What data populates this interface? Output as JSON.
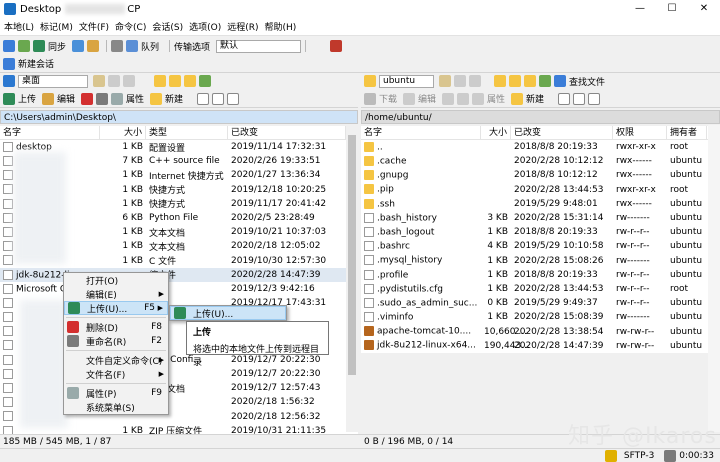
{
  "window": {
    "title": "Desktop",
    "title_suffix": "CP",
    "min": "—",
    "max": "☐",
    "close": "✕"
  },
  "menu": [
    "本地(L)",
    "标记(M)",
    "文件(F)",
    "命令(C)",
    "会话(S)",
    "选项(O)",
    "远程(R)",
    "帮助(H)"
  ],
  "toolbar1": {
    "sync_label": "同步",
    "queue_label": "队列",
    "transfer_label": "传输选项",
    "transfer_value": "默认"
  },
  "toolbar2": {
    "new_session": "新建会话"
  },
  "left": {
    "drive": "桌面",
    "upload": "上传",
    "edit": "编辑",
    "props": "属性",
    "new": "新建",
    "path": "C:\\Users\\admin\\Desktop\\",
    "headers": [
      "名字",
      "大小",
      "类型",
      "已改变"
    ],
    "rows": [
      {
        "name": "desktop",
        "size": "1 KB",
        "type": "配置设置",
        "date": "2019/11/14  17:32:31"
      },
      {
        "name": "",
        "size": "7 KB",
        "type": "C++ source file",
        "date": "2020/2/26  19:33:51"
      },
      {
        "name": "",
        "size": "1 KB",
        "type": "Internet 快捷方式",
        "date": "2020/1/27  13:36:34"
      },
      {
        "name": "",
        "size": "1 KB",
        "type": "快捷方式",
        "date": "2019/12/18  10:20:25"
      },
      {
        "name": "",
        "size": "1 KB",
        "type": "快捷方式",
        "date": "2019/11/17  20:41:42"
      },
      {
        "name": "",
        "size": "6 KB",
        "type": "Python File",
        "date": "2020/2/5  23:28:49"
      },
      {
        "name": "",
        "size": "1 KB",
        "type": "文本文档",
        "date": "2019/10/21  10:37:03"
      },
      {
        "name": "",
        "size": "1 KB",
        "type": "文本文档",
        "date": "2020/2/18  12:05:02"
      },
      {
        "name": "",
        "size": "1 KB",
        "type": "C 文件",
        "date": "2019/10/30  12:57:30"
      },
      {
        "name": "jdk-8u212-lin",
        "size": "",
        "type": "缩文件",
        "date": "2020/2/28  14:47:39"
      },
      {
        "name": "Microsoft O",
        "size": "",
        "type": "",
        "date": "2019/12/3  9:42:16"
      },
      {
        "name": "",
        "size": "",
        "type": "",
        "date": "2019/12/17  17:43:31"
      },
      {
        "name": "",
        "size": "",
        "type": "",
        "date": ""
      },
      {
        "name": "",
        "size": "",
        "type": "",
        "date": ""
      },
      {
        "name": "",
        "size": "",
        "type": "",
        "date": ""
      },
      {
        "name": "",
        "size": "",
        "type": "VPN Confi...",
        "date": "2019/12/7  20:22:30"
      },
      {
        "name": "",
        "size": "",
        "type": "",
        "date": "2019/12/7  20:22:30"
      },
      {
        "name": "",
        "size": "",
        "type": "文本文档",
        "date": "2019/12/7  12:57:43"
      },
      {
        "name": "",
        "size": "",
        "type": "",
        "date": "2020/2/18  1:56:32"
      },
      {
        "name": "",
        "size": "",
        "type": "",
        "date": "2020/2/18  12:56:32"
      },
      {
        "name": "",
        "size": "1 KB",
        "type": "ZIP 压缩文件",
        "date": "2019/10/31  21:11:35"
      }
    ],
    "status": "185 MB / 545 MB,  1 / 87"
  },
  "right": {
    "drive": "ubuntu",
    "download": "下载",
    "edit": "编辑",
    "props": "属性",
    "new": "新建",
    "find": "查找文件",
    "path": "/home/ubuntu/",
    "headers": [
      "名字",
      "大小",
      "已改变",
      "权限",
      "拥有者"
    ],
    "rows": [
      {
        "name": "..",
        "size": "",
        "date": "2018/8/8  20:19:33",
        "perm": "rwxr-xr-x",
        "owner": "root",
        "kind": "up"
      },
      {
        "name": ".cache",
        "size": "",
        "date": "2020/2/28 10:12:12",
        "perm": "rwx------",
        "owner": "ubuntu",
        "kind": "folder"
      },
      {
        "name": ".gnupg",
        "size": "",
        "date": "2018/8/8  10:12:12",
        "perm": "rwx------",
        "owner": "ubuntu",
        "kind": "folder"
      },
      {
        "name": ".pip",
        "size": "",
        "date": "2020/2/28 13:44:53",
        "perm": "rwxr-xr-x",
        "owner": "root",
        "kind": "folder"
      },
      {
        "name": ".ssh",
        "size": "",
        "date": "2019/5/29 9:48:01",
        "perm": "rwx------",
        "owner": "ubuntu",
        "kind": "folder"
      },
      {
        "name": ".bash_history",
        "size": "3 KB",
        "date": "2020/2/28 15:31:14",
        "perm": "rw-------",
        "owner": "ubuntu",
        "kind": "file"
      },
      {
        "name": ".bash_logout",
        "size": "1 KB",
        "date": "2018/8/8  20:19:33",
        "perm": "rw-r--r--",
        "owner": "ubuntu",
        "kind": "file"
      },
      {
        "name": ".bashrc",
        "size": "4 KB",
        "date": "2019/5/29 10:10:58",
        "perm": "rw-r--r--",
        "owner": "ubuntu",
        "kind": "file"
      },
      {
        "name": ".mysql_history",
        "size": "1 KB",
        "date": "2020/2/28 15:08:26",
        "perm": "rw-------",
        "owner": "ubuntu",
        "kind": "file"
      },
      {
        "name": ".profile",
        "size": "1 KB",
        "date": "2018/8/8  20:19:33",
        "perm": "rw-r--r--",
        "owner": "ubuntu",
        "kind": "file"
      },
      {
        "name": ".pydistutils.cfg",
        "size": "1 KB",
        "date": "2020/2/28 13:44:53",
        "perm": "rw-r--r--",
        "owner": "root",
        "kind": "file"
      },
      {
        "name": ".sudo_as_admin_suc...",
        "size": "0 KB",
        "date": "2019/5/29 9:49:37",
        "perm": "rw-r--r--",
        "owner": "ubuntu",
        "kind": "file"
      },
      {
        "name": ".viminfo",
        "size": "1 KB",
        "date": "2020/2/28 15:08:39",
        "perm": "rw-------",
        "owner": "ubuntu",
        "kind": "file"
      },
      {
        "name": "apache-tomcat-10....",
        "size": "10,660 ...",
        "date": "2020/2/28 13:38:54",
        "perm": "rw-rw-r--",
        "owner": "ubuntu",
        "kind": "arch"
      },
      {
        "name": "jdk-8u212-linux-x64...",
        "size": "190,443...",
        "date": "2020/2/28 14:47:39",
        "perm": "rw-rw-r--",
        "owner": "ubuntu",
        "kind": "arch"
      }
    ],
    "status": "0 B / 196 MB,  0 / 14"
  },
  "context_menu": [
    {
      "label": "打开(O)",
      "key": ""
    },
    {
      "label": "编辑(E)",
      "key": "",
      "arrow": true
    },
    {
      "label": "上传(U)...",
      "key": "F5",
      "arrow": true,
      "hl": true
    },
    {
      "label": "删除(D)",
      "key": "F8"
    },
    {
      "label": "重命名(R)",
      "key": "F2"
    },
    {
      "label": "文件自定义命令(C)",
      "key": "",
      "arrow": true
    },
    {
      "label": "文件名(F)",
      "key": "",
      "arrow": true
    },
    {
      "label": "属性(P)",
      "key": "F9"
    },
    {
      "label": "系统菜单(S)",
      "key": ""
    }
  ],
  "submenu": {
    "item": "上传(U)..."
  },
  "tooltip": {
    "title": "上传",
    "desc": "将选中的本地文件上传到远程目录"
  },
  "bottom": {
    "protocol": "SFTP-3",
    "time": "0:00:33"
  },
  "watermark": "知乎 @Ikaros",
  "colors": {
    "selection": "#cce4f7",
    "folder": "#f5c542",
    "accent": "#1a6fc2"
  }
}
